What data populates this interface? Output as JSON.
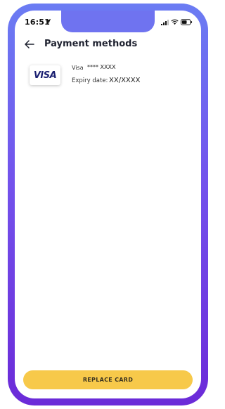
{
  "status_bar": {
    "time": "16:51",
    "icons": [
      "location-arrow-icon",
      "signal-icon",
      "wifi-icon",
      "battery-icon"
    ]
  },
  "header": {
    "back_icon": "back-arrow-icon",
    "title": "Payment methods"
  },
  "card": {
    "logo_text": "VISA",
    "brand": "Visa",
    "number": "**** XXXX",
    "expiry_label": "Expiry date:",
    "expiry_value": "XX/XXXX"
  },
  "footer": {
    "button_label": "REPLACE CARD"
  },
  "colors": {
    "frame_top": "#6b7cf3",
    "frame_bottom": "#6b2ad8",
    "button": "#f7c94a",
    "visa_blue": "#1a1f71"
  }
}
